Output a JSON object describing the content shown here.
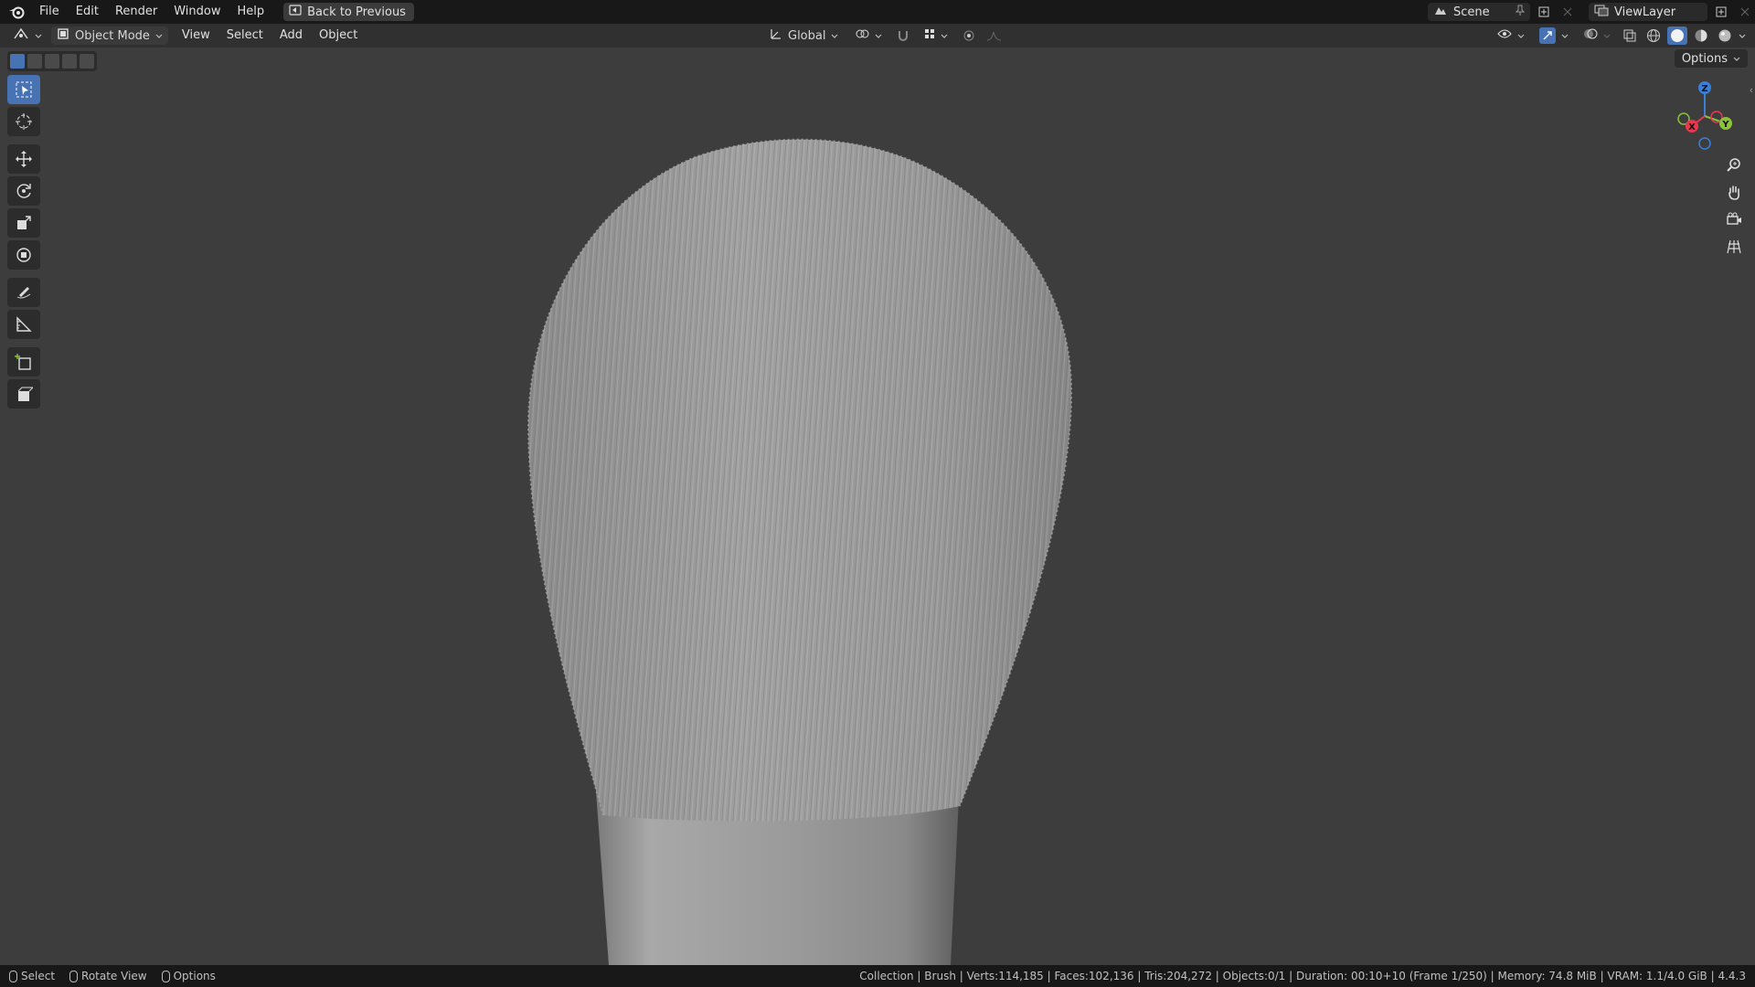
{
  "topbar": {
    "menus": [
      "File",
      "Edit",
      "Render",
      "Window",
      "Help"
    ],
    "back_button": "Back to Previous",
    "scene_name": "Scene",
    "view_layer": "ViewLayer"
  },
  "viewport_header": {
    "mode": "Object Mode",
    "menus": [
      "View",
      "Select",
      "Add",
      "Object"
    ],
    "transform_orientation": "Global"
  },
  "viewport": {
    "options_label": "Options",
    "gizmo_axes": {
      "x": "X",
      "y": "Y",
      "z": "Z"
    },
    "tools": [
      "select-box",
      "cursor",
      "move",
      "rotate",
      "scale",
      "transform",
      "annotate",
      "measure",
      "add-cube",
      "add-object"
    ]
  },
  "statusbar": {
    "hints": [
      "Select",
      "Rotate View",
      "Options"
    ],
    "stats": "Collection | Brush | Verts:114,185 | Faces:102,136 | Tris:204,272 | Objects:0/1 | Duration: 00:10+10 (Frame 1/250) | Memory: 74.8 MiB | VRAM: 1.1/4.0 GiB | 4.4.3"
  },
  "colors": {
    "accent": "#4772b3",
    "axis_x": "#e8384f",
    "axis_y": "#8ac33a",
    "axis_z": "#3a7fd8"
  }
}
